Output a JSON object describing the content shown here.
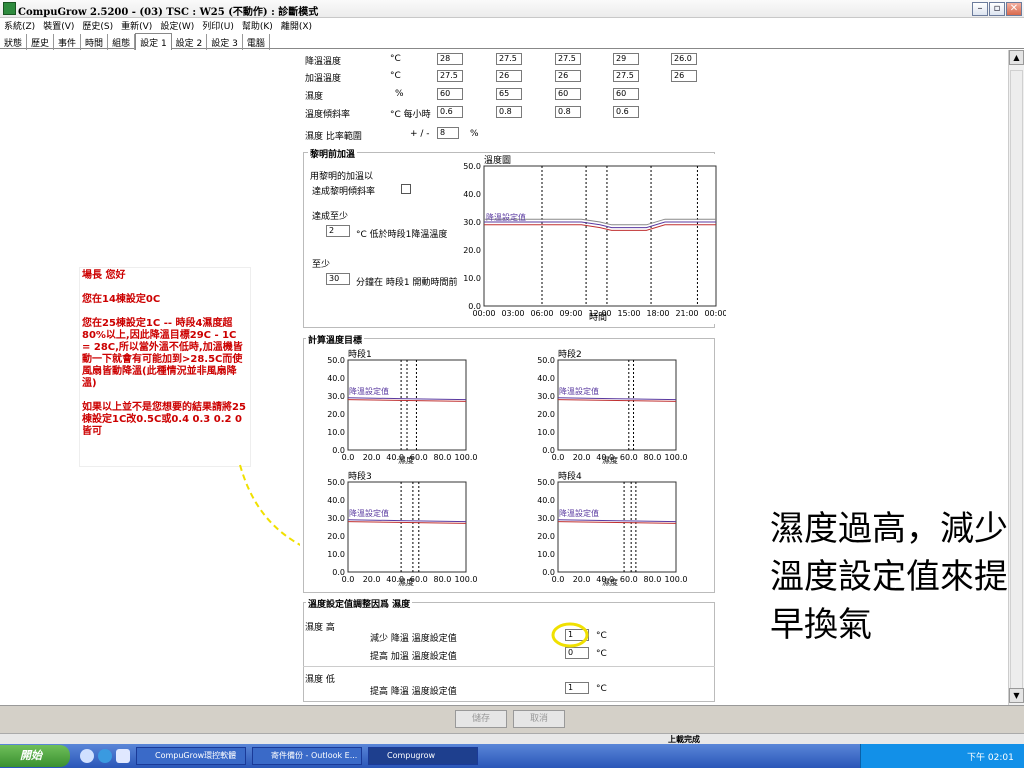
{
  "window": {
    "title": "CompuGrow 2.5200 - (03) TSC : W25 (不動作) : 診斷模式",
    "min": "–",
    "restore": "▫",
    "close": "✕"
  },
  "menu": [
    "系統(Z)",
    "裝置(V)",
    "歷史(S)",
    "重新(V)",
    "設定(W)",
    "列印(U)",
    "幫助(K)",
    "離開(X)"
  ],
  "tabs": [
    "狀態",
    "歷史",
    "事件",
    "時間",
    "組態",
    "設定 1",
    "設定 2",
    "設定 3",
    "電腦"
  ],
  "active_tab": "設定 1",
  "settings_rows": [
    {
      "label": "降溫溫度",
      "unit": "°C",
      "values": [
        "28",
        "27.5",
        "27.5",
        "29",
        "26.0"
      ]
    },
    {
      "label": "加溫溫度",
      "unit": "°C",
      "values": [
        "27.5",
        "26",
        "26",
        "27.5",
        "26"
      ]
    },
    {
      "label": "濕度",
      "unit": "%",
      "values": [
        "60",
        "65",
        "60",
        "60",
        ""
      ]
    },
    {
      "label": "溫度傾斜率",
      "unit": "°C 每小時",
      "values": [
        "0.6",
        "0.8",
        "0.8",
        "0.6",
        ""
      ]
    }
  ],
  "hum_ratio": {
    "label": "濕度 比率範圍",
    "pm": "+ / -",
    "value": "8",
    "unit": "%"
  },
  "dawn": {
    "title": "黎明前加溫",
    "line1": "用黎明的加溫以",
    "line2": "達成黎明傾斜率",
    "reach_label": "達成至少",
    "reach_value": "2",
    "reach_unit": "°C 低於時段1降溫溫度",
    "min_label": "至少",
    "min_value": "30",
    "min_unit": "分鐘在 時段1 開動時間前"
  },
  "temp_chart": {
    "title": "溫度圖",
    "xlabel": "時間",
    "x_ticks": [
      "00:00",
      "03:00",
      "06:00",
      "09:00",
      "12:00",
      "15:00",
      "18:00",
      "21:00",
      "00:00"
    ],
    "y_ticks": [
      "50.0",
      "40.0",
      "30.0",
      "20.0",
      "10.0",
      "0.0"
    ],
    "series_label": "降溫設定值"
  },
  "calc_section": {
    "title": "計算溫度目標"
  },
  "period_charts": [
    {
      "title": "時段1",
      "xlabel": "濕度",
      "x_ticks": [
        "0.0",
        "20.0",
        "40.0",
        "60.0",
        "80.0",
        "100.0"
      ],
      "y_ticks": [
        "50.0",
        "40.0",
        "30.0",
        "20.0",
        "10.0",
        "0.0"
      ],
      "series_label": "降溫設定值"
    },
    {
      "title": "時段2",
      "xlabel": "濕度",
      "x_ticks": [
        "0.0",
        "20.0",
        "40.0",
        "60.0",
        "80.0",
        "100.0"
      ],
      "y_ticks": [
        "50.0",
        "40.0",
        "30.0",
        "20.0",
        "10.0",
        "0.0"
      ],
      "series_label": "降溫設定值"
    },
    {
      "title": "時段3",
      "xlabel": "濕度",
      "x_ticks": [
        "0.0",
        "20.0",
        "40.0",
        "60.0",
        "80.0",
        "100.0"
      ],
      "y_ticks": [
        "50.0",
        "40.0",
        "30.0",
        "20.0",
        "10.0",
        "0.0"
      ],
      "series_label": "降溫設定值"
    },
    {
      "title": "時段4",
      "xlabel": "濕度",
      "x_ticks": [
        "0.0",
        "20.0",
        "40.0",
        "60.0",
        "80.0",
        "100.0"
      ],
      "y_ticks": [
        "50.0",
        "40.0",
        "30.0",
        "20.0",
        "10.0",
        "0.0"
      ],
      "series_label": "降溫設定值"
    }
  ],
  "adjust": {
    "title": "溫度設定值調整因爲 濕度",
    "high_label": "濕度 高",
    "low_label": "濕度 低",
    "row1": "減少 降溫 溫度設定值",
    "row1_value": "1",
    "row2": "提高 加溫 溫度設定值",
    "row2_value": "0",
    "row3": "提高 降溫 溫度設定值",
    "row3_value": "1",
    "unit": "°C"
  },
  "note": {
    "p1": "場長 您好",
    "p2": "您在14棟設定0C",
    "p3": "您在25棟設定1C -- 時段4濕度超80%以上,因此降溫目標29C - 1C = 28C,所以當外溫不低時,加溫機皆動一下就會有可能加到>28.5C而使風扇皆動降溫(此種情況並非風扇降溫)",
    "p4": "如果以上並不是您想要的結果請將25棟設定1C改0.5C或0.4 0.3 0.2 0皆可"
  },
  "annotation_text": "濕度過高，減少溫度設定值來提早換氣",
  "buttons": {
    "save": "儲存",
    "cancel": "取消"
  },
  "status": {
    "text": "上載完成"
  },
  "taskbar": {
    "start": "開始",
    "tasks": [
      "CompuGrow環控軟體",
      "寄件備份 - Outlook E...",
      "Compugrow"
    ],
    "clock": "下午 02:01"
  },
  "colors": {
    "series": "#5a3aa0",
    "series2": "#c03030",
    "highlight": "#f0e000"
  }
}
